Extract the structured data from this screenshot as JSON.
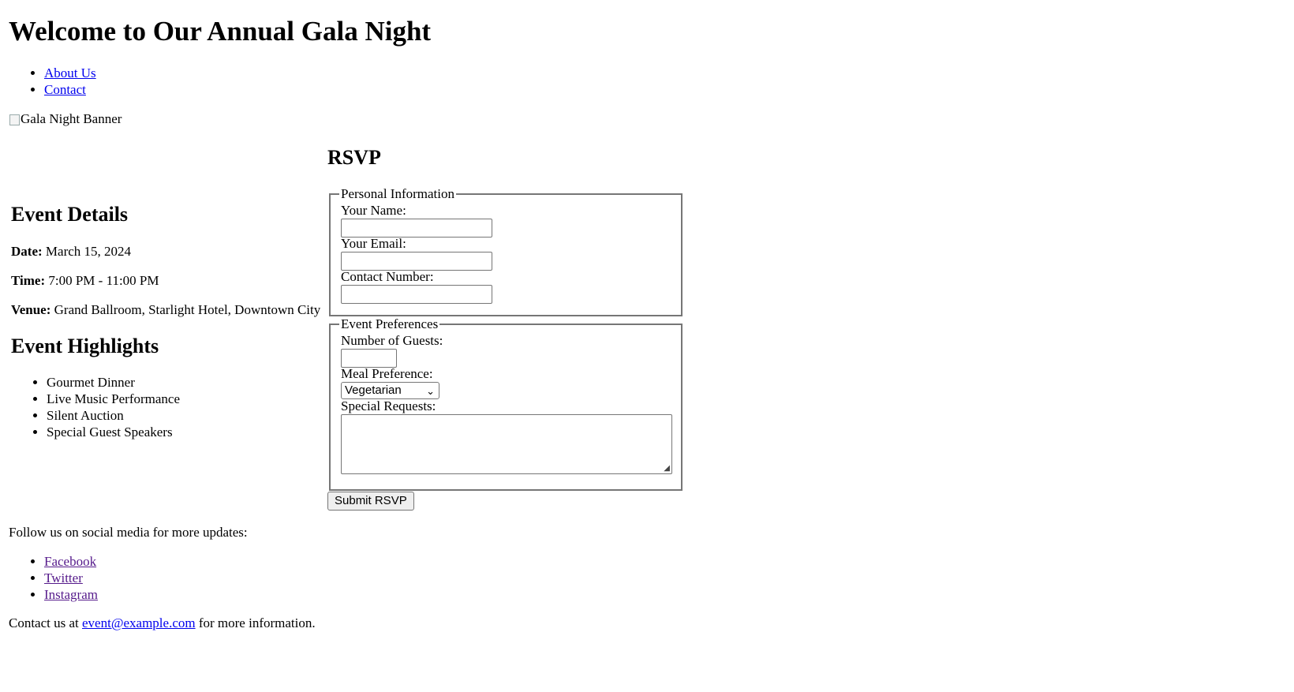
{
  "header": {
    "title": "Welcome to Our Annual Gala Night",
    "nav": [
      {
        "label": "About Us"
      },
      {
        "label": "Contact"
      }
    ]
  },
  "banner": {
    "alt_text": "Gala Night Banner",
    "icon": "broken-image-icon"
  },
  "event_details": {
    "heading": "Event Details",
    "date_label": "Date:",
    "date_value": "March 15, 2024",
    "time_label": "Time:",
    "time_value": "7:00 PM - 11:00 PM",
    "venue_label": "Venue:",
    "venue_value": "Grand Ballroom, Starlight Hotel, Downtown City"
  },
  "highlights": {
    "heading": "Event Highlights",
    "items": [
      "Gourmet Dinner",
      "Live Music Performance",
      "Silent Auction",
      "Special Guest Speakers"
    ]
  },
  "rsvp": {
    "heading": "RSVP",
    "personal": {
      "legend": "Personal Information",
      "name_label": "Your Name:",
      "name_value": "",
      "email_label": "Your Email:",
      "email_value": "",
      "phone_label": "Contact Number:",
      "phone_value": ""
    },
    "preferences": {
      "legend": "Event Preferences",
      "guests_label": "Number of Guests:",
      "guests_value": "",
      "meal_label": "Meal Preference:",
      "meal_selected": "Vegetarian",
      "requests_label": "Special Requests:",
      "requests_value": ""
    },
    "submit_label": "Submit RSVP"
  },
  "footer": {
    "social_text": "Follow us on social media for more updates:",
    "social_links": [
      {
        "label": "Facebook"
      },
      {
        "label": "Twitter"
      },
      {
        "label": "Instagram"
      }
    ],
    "contact_prefix": "Contact us at",
    "contact_email": "event@example.com",
    "contact_suffix": "for more information."
  },
  "colors": {
    "link": "#0000ee",
    "visited_link": "#551a8b",
    "border": "#767676",
    "button_bg": "#efefef"
  }
}
